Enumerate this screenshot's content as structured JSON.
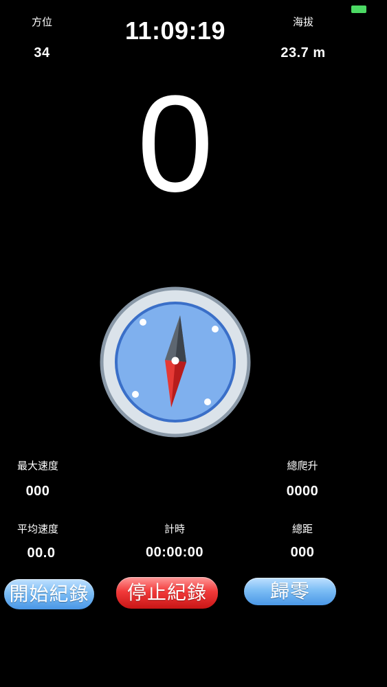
{
  "status_bar": {
    "battery_color": "#4cd964"
  },
  "header": {
    "bearing_label": "方位",
    "bearing_value": "34",
    "clock": "11:09:19",
    "altitude_label": "海拔",
    "altitude_value": "23.7 m"
  },
  "speed": {
    "value": "0"
  },
  "compass": {
    "icon": "compass-icon",
    "colors": {
      "outer_ring": "#dbe3ea",
      "ring_border": "#8a99a8",
      "face": "#7fb0ee",
      "face_border": "#3a6fc8",
      "needle_north": "#5d6670",
      "needle_south": "#e53935"
    }
  },
  "stats": {
    "max_speed_label": "最大速度",
    "max_speed_value": "000",
    "total_climb_label": "總爬升",
    "total_climb_value": "0000",
    "avg_speed_label": "平均速度",
    "avg_speed_value": "00.0",
    "timer_label": "計時",
    "timer_value": "00:00:00",
    "total_distance_label": "總距",
    "total_distance_value": "000"
  },
  "buttons": {
    "start_label": "開始紀錄",
    "stop_label": "停止紀錄",
    "reset_label": "歸零"
  }
}
